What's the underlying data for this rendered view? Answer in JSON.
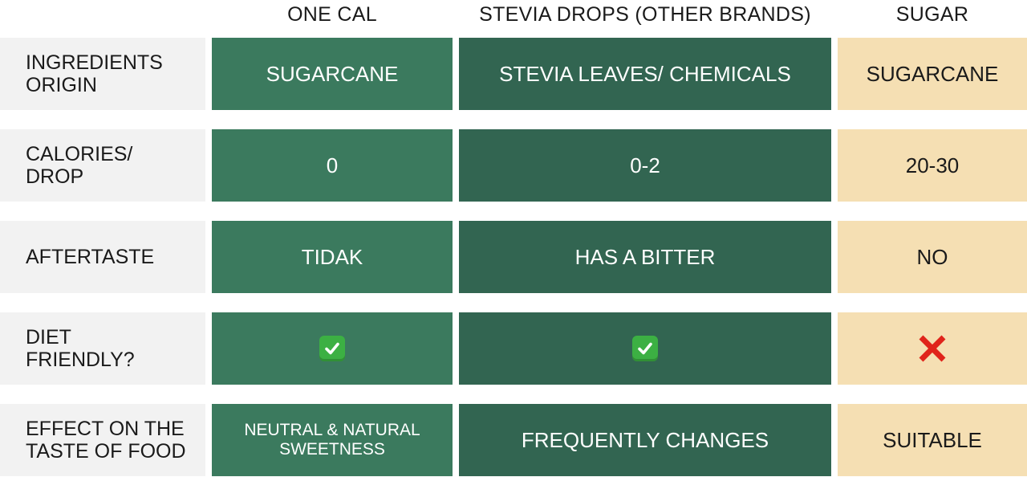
{
  "columns": [
    "ONE CAL",
    "STEVIA DROPS (OTHER BRANDS)",
    "SUGAR"
  ],
  "rows": [
    {
      "label": "INGREDIENTS\nORIGIN",
      "one_cal": "SUGARCANE",
      "stevia": "STEVIA LEAVES/ CHEMICALS",
      "sugar": "SUGARCANE"
    },
    {
      "label": "CALORIES/\nDROP",
      "one_cal": "0",
      "stevia": "0-2",
      "sugar": "20-30"
    },
    {
      "label": "AFTERTASTE",
      "one_cal": "TIDAK",
      "stevia": "HAS A BITTER",
      "sugar": "NO"
    },
    {
      "label": "DIET\nFRIENDLY?",
      "one_cal": "check-mark-icon",
      "stevia": "check-mark-icon",
      "sugar": "cross-mark-icon"
    },
    {
      "label": "EFFECT ON THE\nTASTE OF FOOD",
      "one_cal": "NEUTRAL & NATURAL\nSWEETNESS",
      "stevia": "FREQUENTLY CHANGES",
      "sugar": "SUITABLE"
    }
  ],
  "colors": {
    "label_bg": "#f2f2f2",
    "one_cal_bg": "#3b7a5e",
    "stevia_bg": "#326551",
    "sugar_bg": "#f5dfb3",
    "check_green": "#3cb043",
    "cross_red": "#e0241b"
  }
}
